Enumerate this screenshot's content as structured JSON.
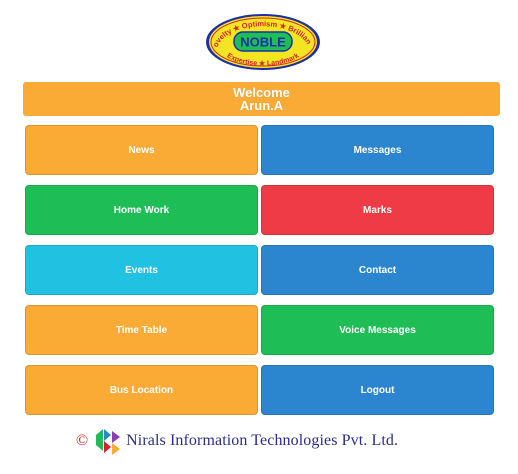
{
  "logo": {
    "center_text": "NOBLE",
    "ring_words": [
      "Novelty",
      "Optimism",
      "Brilliance",
      "Expertise",
      "Landmark"
    ]
  },
  "welcome": {
    "greeting": "Welcome",
    "user_name": "Arun.A"
  },
  "tiles": [
    {
      "label": "News",
      "color": "#f9ab36"
    },
    {
      "label": "Messages",
      "color": "#2b85cf"
    },
    {
      "label": "Home Work",
      "color": "#1fbd55"
    },
    {
      "label": "Marks",
      "color": "#ee3b46"
    },
    {
      "label": "Events",
      "color": "#21c1e2"
    },
    {
      "label": "Contact",
      "color": "#2b85cf"
    },
    {
      "label": "Time Table",
      "color": "#f9ab36"
    },
    {
      "label": "Voice Messages",
      "color": "#1fbd55"
    },
    {
      "label": "Bus Location",
      "color": "#f9ab36"
    },
    {
      "label": "Logout",
      "color": "#2b85cf"
    }
  ],
  "footer": {
    "copyright_symbol": "©",
    "company": "Nirals Information Technologies Pvt. Ltd."
  }
}
